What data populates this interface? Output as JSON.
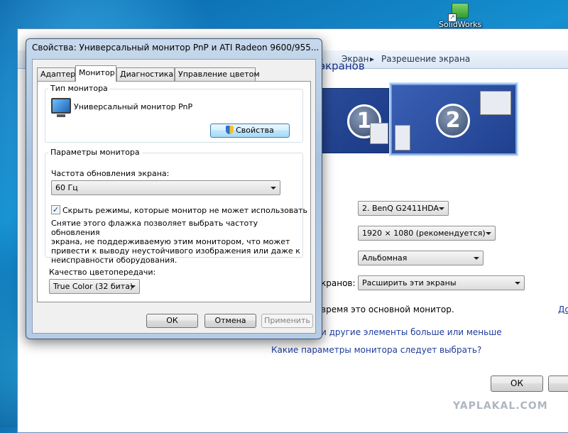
{
  "desktop": {
    "icon_label": "SolidWorks"
  },
  "control_panel": {
    "breadcrumb": [
      "Экран",
      "Разрешение экрана"
    ],
    "title": "им экранов",
    "monitor_numbers": [
      "1",
      "2"
    ],
    "display_combo": "2. BenQ G2411HDA",
    "resolution_combo": "1920 × 1080 (рекомендуется)",
    "orientation_combo": "Альбомная",
    "multi_label": "кранов:",
    "multi_combo": "Расширить эти экраны",
    "main_monitor_text": "время это основной монитор.",
    "side_link": "До",
    "link_text_size": "и другие элементы больше или меньше",
    "link_which_params": "Какие параметры монитора следует выбрать?",
    "ok_label": "ОК"
  },
  "dialog": {
    "title": "Свойства: Универсальный монитор PnP и ATI Radeon 9600/955...",
    "tabs": [
      "Адаптер",
      "Монитор",
      "Диагностика",
      "Управление цветом"
    ],
    "active_tab": "Монитор",
    "monitor_type_group": "Тип монитора",
    "monitor_name": "Универсальный монитор PnP",
    "properties_button": "Свойства",
    "monitor_params_group": "Параметры монитора",
    "refresh_label": "Частота обновления экрана:",
    "refresh_value": "60 Гц",
    "hide_modes_label": "Скрыть режимы, которые монитор не может использовать",
    "hide_modes_checked": true,
    "description": "Снятие этого флажка позволяет выбрать частоту обновления\nэкрана, не поддерживаемую этим монитором, что может\nпривести к выводу неустойчивого изображения или даже к\nнеисправности оборудования.",
    "color_quality_label": "Качество цветопередачи:",
    "color_quality_value": "True Color (32 бита)",
    "buttons": {
      "ok": "ОК",
      "cancel": "Отмена",
      "apply": "Применить"
    }
  },
  "watermark": "YAPLAKAL.COM"
}
